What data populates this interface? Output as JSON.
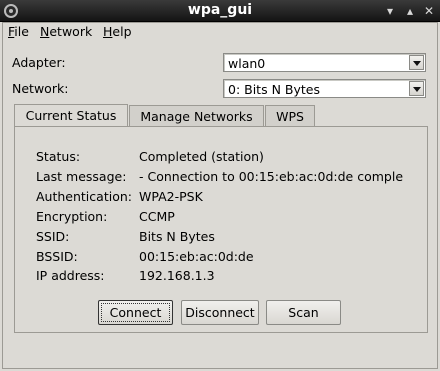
{
  "window": {
    "title": "wpa_gui",
    "controls": {
      "minimize": "▾",
      "maximize": "▴",
      "close": "✕"
    }
  },
  "menu": {
    "file": "File",
    "file_u": "F",
    "file_rest": "ile",
    "network": "Network",
    "network_u": "N",
    "network_rest": "etwork",
    "help": "Help",
    "help_u": "H",
    "help_rest": "elp"
  },
  "adapter": {
    "label": "Adapter:",
    "value": "wlan0"
  },
  "network_select": {
    "label": "Network:",
    "value": "0: Bits N Bytes"
  },
  "tabs": [
    {
      "label": "Current Status",
      "active": true
    },
    {
      "label": "Manage Networks",
      "active": false
    },
    {
      "label": "WPS",
      "active": false
    }
  ],
  "status": {
    "rows": [
      {
        "key": "Status:",
        "value": "Completed (station)"
      },
      {
        "key": "Last message:",
        "value": "- Connection to 00:15:eb:ac:0d:de comple"
      },
      {
        "key": "Authentication:",
        "value": "WPA2-PSK"
      },
      {
        "key": "Encryption:",
        "value": "CCMP"
      },
      {
        "key": "SSID:",
        "value": "Bits N Bytes"
      },
      {
        "key": "BSSID:",
        "value": "00:15:eb:ac:0d:de"
      },
      {
        "key": "IP address:",
        "value": "192.168.1.3"
      }
    ]
  },
  "buttons": {
    "connect": "Connect",
    "disconnect": "Disconnect",
    "scan": "Scan"
  }
}
